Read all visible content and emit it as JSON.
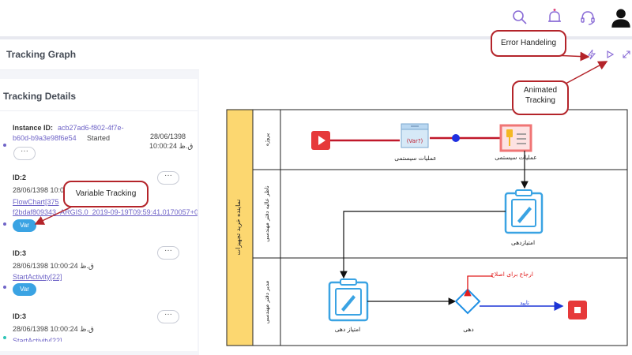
{
  "header": {
    "icons": [
      "search-icon",
      "bell-icon",
      "headset-icon",
      "user-icon"
    ],
    "accent": "#8a6cd6"
  },
  "page": {
    "title": "Tracking Graph",
    "toolbar_icons": [
      "lightning-icon",
      "play-icon",
      "expand-icon"
    ]
  },
  "details": {
    "title": "Tracking Details",
    "instance": {
      "label": "Instance ID:",
      "id_line1": "acb27ad6-f802-4f7e-",
      "id_line2": "b60d-b9a3e98f6e54",
      "status": "Started",
      "date": "28/06/1398",
      "time": "10:00:24 ق.ظ"
    },
    "items": [
      {
        "id": "ID:2",
        "date": "28/06/1398 10:00:24 ق.ظ",
        "link1": "FlowChart[375",
        "link2": "f2bdaf809343_ARGIS.0_2019-09-19T09:59:41.0170057+0",
        "var": "Var"
      },
      {
        "id": "ID:3",
        "date": "28/06/1398 10:00:24 ق.ظ",
        "link1": "StartActivity[22]",
        "var": "Var"
      },
      {
        "id": "ID:3",
        "date": "28/06/1398 10:00:24 ق.ظ",
        "link1": "StartActivity[22]"
      }
    ],
    "menu_glyph": "···"
  },
  "callouts": {
    "error": "Error Handeling",
    "animated_line1": "Animated",
    "animated_line2": "Tracking",
    "variable": "Variable Tracking"
  },
  "diagram": {
    "pool_label": "نماینده خرید تجهیزات",
    "lanes": [
      "پروژه",
      "ناظر عالیه دفتر مهندسی",
      "مدیر دفتر مهندسی"
    ],
    "tasks": {
      "system_ops_1": "عملیات سیستمی",
      "system_ops_2": "عملیات سیستمی",
      "var_token": "(Var?)",
      "scoring_1": "امتیازدهی",
      "scoring_2": "امتیاز دهی",
      "gateway": "دهی"
    },
    "flows": {
      "return": "ارجاع برای اصلاح",
      "approve": "تایید"
    },
    "colors": {
      "pool_header": "#fcd770",
      "start": "#e6393a",
      "end": "#e6393a",
      "task_blue": "#3aa3e3",
      "gateway": "#1f8fe4",
      "animated_flow": "#c0182a",
      "approve_flow": "#1c35d6",
      "return_flow": "#e11d1d"
    }
  }
}
